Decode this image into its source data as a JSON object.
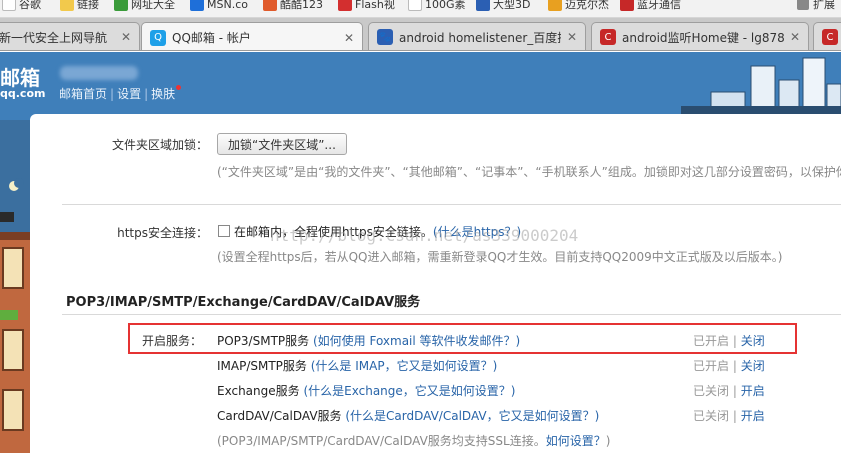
{
  "bookmarks": [
    {
      "label": "谷歌",
      "color": "#f0f0f0"
    },
    {
      "label": "链接",
      "color": "#f2c94c"
    },
    {
      "label": "网址大全",
      "color": "#3a9b3a"
    },
    {
      "label": "MSN.co",
      "color": "#1e6fd9"
    },
    {
      "label": "酷酷123",
      "color": "#e05a2b"
    },
    {
      "label": "Flash视",
      "color": "#d32f2f"
    },
    {
      "label": "100G素",
      "color": "#f0f0f0"
    },
    {
      "label": "大型3D",
      "color": "#2b5fb3"
    },
    {
      "label": "迈克尔杰",
      "color": "#e8a020"
    },
    {
      "label": "蓝牙通信",
      "color": "#c62828"
    }
  ],
  "bookmarks_extra": "扩展",
  "tabs": [
    {
      "title": "新一代安全上网导航",
      "active": false,
      "favicon": "",
      "fav_color": "#f0f0f0"
    },
    {
      "title": "QQ邮箱 - 帐户",
      "active": true,
      "favicon": "Q",
      "fav_color": "#1ea0e8"
    },
    {
      "title": "android homelistener_百度搜",
      "active": false,
      "favicon": "🐾",
      "fav_color": "#2b5fb3"
    },
    {
      "title": "android监听Home键 - lg878",
      "active": false,
      "favicon": "C",
      "fav_color": "#c62828"
    },
    {
      "title": "",
      "active": false,
      "favicon": "C",
      "fav_color": "#c62828"
    }
  ],
  "header": {
    "brand": "邮箱",
    "brand_sub": "qq.com",
    "nav": [
      "邮箱首页",
      "设置",
      "换肤"
    ]
  },
  "folder_lock": {
    "label": "文件夹区域加锁：",
    "button": "加锁“文件夹区域”...",
    "hint": "(“文件夹区域”是由“我的文件夹”、“其他邮箱”、“记事本”、“手机联系人”组成。加锁即对这几部分设置密码，以保护你"
  },
  "https": {
    "label": "https安全连接：",
    "checkbox_text": "在邮箱内，全程使用https安全链接。",
    "checkbox_link": "(什么是https？)",
    "hint": "(设置全程https后，若从QQ进入邮箱，需重新登录QQ才生效。目前支持QQ2009中文正式版及以后版本。)"
  },
  "watermark": "http://blog.csdn.net/as339000204",
  "services": {
    "title": "POP3/IMAP/SMTP/Exchange/CardDAV/CalDAV服务",
    "label": "开启服务：",
    "items": [
      {
        "name": "POP3/SMTP服务",
        "help": "(如何使用 Foxmail 等软件收发邮件？)",
        "state": "已开启",
        "action": "关闭"
      },
      {
        "name": "IMAP/SMTP服务",
        "help": "(什么是 IMAP，它又是如何设置？)",
        "state": "已开启",
        "action": "关闭"
      },
      {
        "name": "Exchange服务",
        "help": "(什么是Exchange，它又是如何设置？)",
        "state": "已关闭",
        "action": "开启"
      },
      {
        "name": "CardDAV/CalDAV服务",
        "help": "(什么是CardDAV/CalDAV，它又是如何设置？)",
        "state": "已关闭",
        "action": "开启"
      }
    ],
    "ssl_note": "(POP3/IMAP/SMTP/CardDAV/CalDAV服务均支持SSL连接。",
    "ssl_link": "如何设置？",
    "ssl_close": ")"
  }
}
